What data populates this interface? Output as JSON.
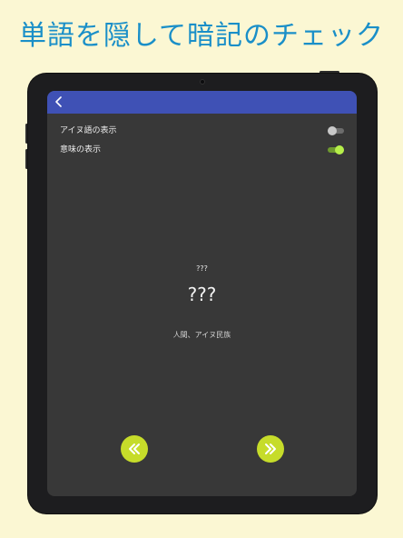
{
  "promo": {
    "headline": "単語を隠して暗記のチェック"
  },
  "appbar": {
    "back_icon": "chevron-left-icon",
    "color": "#3f51b5"
  },
  "settings": {
    "show_ainu": {
      "label": "アイヌ語の表示",
      "enabled": false
    },
    "show_meaning": {
      "label": "意味の表示",
      "enabled": true
    }
  },
  "card": {
    "pronunciation": "???",
    "word": "???",
    "meaning": "人間、アイヌ民族"
  },
  "navigation": {
    "previous_icon": "double-chevron-left-icon",
    "next_icon": "double-chevron-right-icon",
    "button_color": "#c6dc2a"
  },
  "colors": {
    "background": "#fbf7d3",
    "headline": "#1a8fc8",
    "screen": "#383838"
  }
}
